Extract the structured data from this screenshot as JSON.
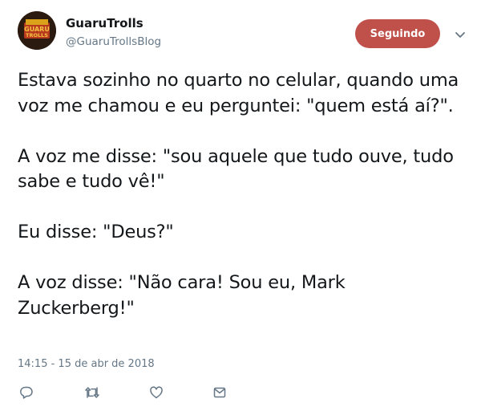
{
  "tweet": {
    "user": {
      "display_name": "GuaruTrolls",
      "handle": "@GuaruTrollsBlog",
      "avatar_text_top": "GUARU",
      "avatar_text_bottom": "TROLLS"
    },
    "follow_button_label": "Seguindo",
    "text_paragraphs": [
      "Estava sozinho no quarto no celular, quando uma voz me chamou e eu perguntei: \"quem está aí?\".",
      "A voz me disse: \"sou aquele que tudo ouve, tudo sabe e tudo vê!\"",
      "Eu disse: \"Deus?\"",
      "A voz disse: \"Não cara! Sou eu, Mark Zuckerberg!\""
    ],
    "timestamp": "14:15 - 15 de abr de 2018",
    "actions": [
      "reply-icon",
      "retweet-icon",
      "like-icon",
      "direct-message-icon"
    ]
  },
  "colors": {
    "follow_button_bg": "#c0504a",
    "secondary_text": "#657786",
    "primary_text": "#14171a",
    "icon_gray": "#657786"
  }
}
